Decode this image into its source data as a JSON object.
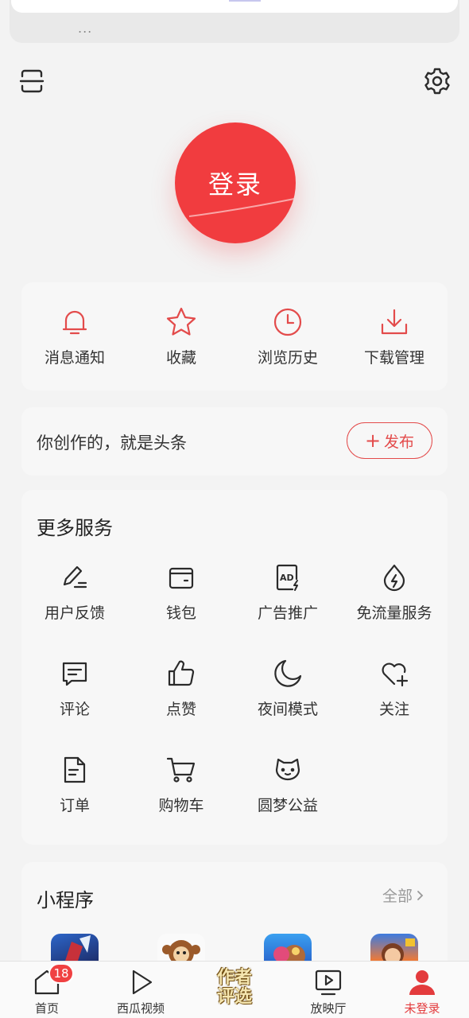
{
  "header": {
    "scan_icon": "scan-icon",
    "settings_icon": "gear-icon",
    "dots": "..."
  },
  "login": {
    "label": "登录"
  },
  "quick_actions": [
    {
      "label": "消息通知",
      "icon": "bell-icon"
    },
    {
      "label": "收藏",
      "icon": "star-icon"
    },
    {
      "label": "浏览历史",
      "icon": "clock-icon"
    },
    {
      "label": "下载管理",
      "icon": "download-icon"
    }
  ],
  "create": {
    "text": "你创作的，就是头条",
    "publish_label": "发布"
  },
  "services": {
    "title": "更多服务",
    "items": [
      {
        "label": "用户反馈",
        "icon": "pencil-icon"
      },
      {
        "label": "钱包",
        "icon": "wallet-icon"
      },
      {
        "label": "广告推广",
        "icon": "ad-icon"
      },
      {
        "label": "免流量服务",
        "icon": "data-drop-icon"
      },
      {
        "label": "评论",
        "icon": "comment-icon"
      },
      {
        "label": "点赞",
        "icon": "thumbs-up-icon"
      },
      {
        "label": "夜间模式",
        "icon": "moon-icon"
      },
      {
        "label": "关注",
        "icon": "heart-plus-icon"
      },
      {
        "label": "订单",
        "icon": "document-icon"
      },
      {
        "label": "购物车",
        "icon": "cart-icon"
      },
      {
        "label": "圆梦公益",
        "icon": "cat-face-icon"
      }
    ]
  },
  "mini_programs": {
    "title": "小程序",
    "all_label": "全部",
    "apps": [
      "mini-app-1",
      "mini-app-2",
      "mini-app-3",
      "mini-app-4"
    ]
  },
  "promo": {
    "text_line1": "作者",
    "text_line2": "评选"
  },
  "tabbar": {
    "tabs": [
      {
        "label": "首页",
        "icon": "home-icon",
        "badge": "18"
      },
      {
        "label": "西瓜视频",
        "icon": "play-icon"
      },
      {
        "label": "放映厅",
        "icon": "screen-play-icon"
      },
      {
        "label": "未登录",
        "icon": "user-icon"
      }
    ],
    "active_color": "#e33b3d"
  },
  "colors": {
    "accent": "#f13c3f",
    "icon_red": "#e34b4b",
    "icon_dark": "#2b2b2b"
  }
}
